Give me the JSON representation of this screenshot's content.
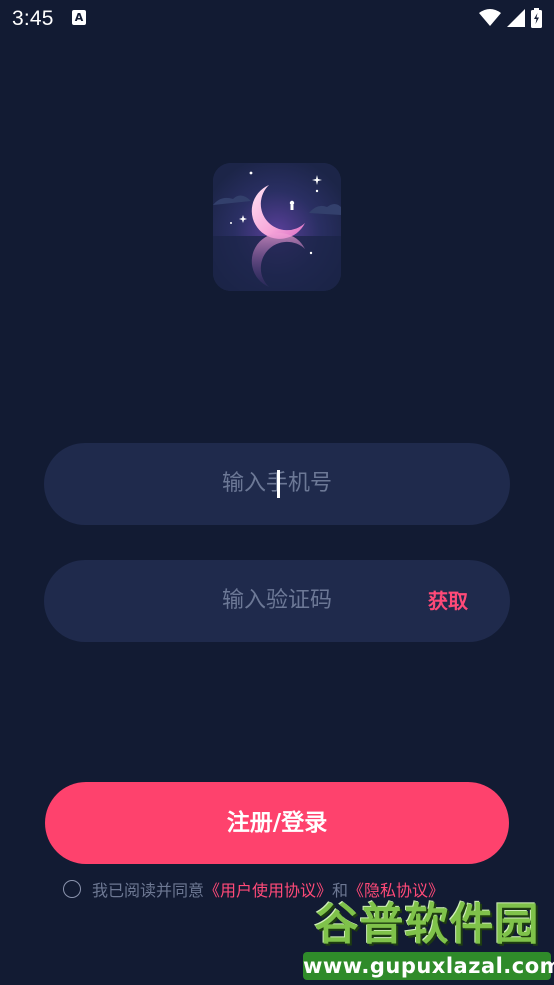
{
  "status_bar": {
    "time": "3:45",
    "notification_letter": "A"
  },
  "login": {
    "phone_placeholder": "输入手机号",
    "code_placeholder": "输入验证码",
    "get_code_label": "获取",
    "submit_label": "注册/登录"
  },
  "agreement": {
    "prefix": "我已阅读并同意",
    "user_agreement": "《用户使用协议》",
    "conjunction": "和",
    "privacy_policy": "《隐私协议》",
    "checked": false
  },
  "watermark": {
    "title": "谷普软件园",
    "url": "www.gupuxlazal.com"
  },
  "colors": {
    "background": "#121b33",
    "field": "#1f2a4c",
    "accent": "#fe426d"
  }
}
